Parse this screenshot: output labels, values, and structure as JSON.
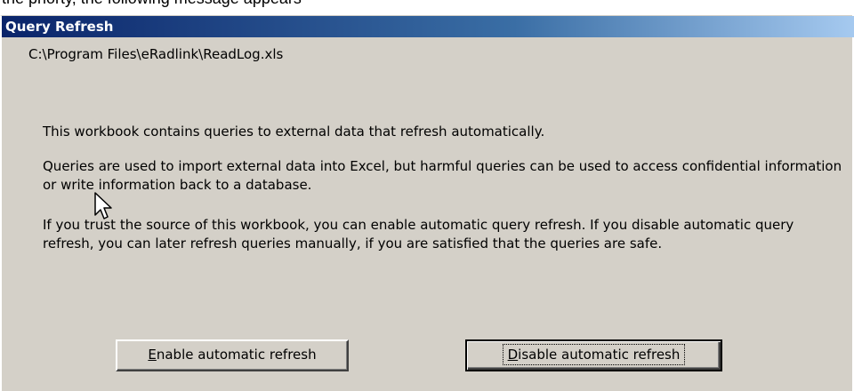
{
  "top_partial_text": "the priorty, the following message appears",
  "window": {
    "title": "Query Refresh"
  },
  "dialog": {
    "file_path": "C:\\Program Files\\eRadlink\\ReadLog.xls",
    "message_1": "This workbook contains queries to external data that refresh automatically.",
    "message_2": "Queries are used to import external data into Excel, but harmful queries can be used to access confidential information or write information back to a database.",
    "message_3": "If you trust the source of this workbook, you can enable automatic query refresh. If you disable automatic query refresh, you can later refresh queries manually, if you are satisfied that the queries are safe."
  },
  "buttons": {
    "enable": {
      "mnemonic": "E",
      "rest": "nable automatic refresh"
    },
    "disable": {
      "mnemonic": "D",
      "rest": "isable automatic refresh"
    }
  },
  "icons": {
    "cursor": "mouse-pointer-icon"
  }
}
